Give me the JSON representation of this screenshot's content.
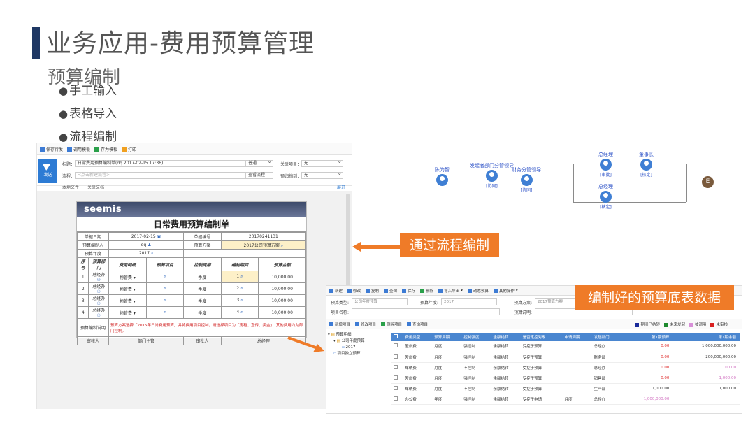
{
  "slide": {
    "title": "业务应用-费用预算管理",
    "subtitle": "预算编制",
    "bullets": [
      "手工输入",
      "表格导入",
      "流程编制"
    ]
  },
  "callouts": {
    "flow": "通过流程编制",
    "table": "编制好的预算底表数据"
  },
  "form_screen": {
    "toolbar": [
      "保存待发",
      "调用模板",
      "存为模板",
      "打印"
    ],
    "send_label": "发送",
    "title_label": "标题：",
    "title_value": "日常费用预算编制单(dq 2017-02-15 17:36)",
    "priority_value": "普通",
    "related_label": "关联项目：",
    "related_value": "无",
    "process_label": "流程：",
    "process_placeholder": "<点击新建流程>",
    "view_flow": "查看流程",
    "deadline_label": "预归档到：",
    "deadline_value": "无",
    "links": [
      "本地文件",
      "关联文档"
    ],
    "expand": "展开",
    "logo": "seemis",
    "doc_title": "日常费用预算编制单",
    "fields": {
      "date_label": "单据日期",
      "date_value": "2017-02-15",
      "no_label": "单据编号",
      "no_value": "20170241131",
      "person_label": "预算编制人",
      "person_value": "dq",
      "plan_label": "预算方案",
      "plan_value": "2017公司预算方案",
      "year_label": "预算年度",
      "year_value": "2017"
    },
    "columns": [
      "序号",
      "预算部门",
      "费用明细",
      "预算项目",
      "控制周期",
      "编制期间",
      "预算金额"
    ],
    "rows": [
      [
        "1",
        "总经办",
        "物管费",
        "",
        "季度",
        "1",
        "10,000.00"
      ],
      [
        "2",
        "总经办",
        "物管费",
        "",
        "季度",
        "2",
        "10,000.00"
      ],
      [
        "3",
        "总经办",
        "物管费",
        "",
        "季度",
        "3",
        "10,000.00"
      ],
      [
        "4",
        "总经办",
        "物管费",
        "",
        "季度",
        "4",
        "10,000.00"
      ]
    ],
    "note_label": "预算编制说明",
    "note_text": "预算方案选择「2015年日常费用预算」并将费用项目控制，请选择项目为「房租、宣传、奖金」，其他费用均为部门控制。",
    "sign": [
      "审核人",
      "部门主管",
      "审批人",
      "总经理"
    ]
  },
  "flow": {
    "nodes": [
      {
        "label": "陈为智",
        "sub": ""
      },
      {
        "label": "发起者部门分管领导",
        "sub": "[协同]"
      },
      {
        "label": "财务分管领导",
        "sub": "[协同]"
      },
      {
        "label": "总经理",
        "sub": "[审批]"
      },
      {
        "label": "董事长",
        "sub": "[核定]"
      },
      {
        "label": "总经理",
        "sub": "[核定]"
      }
    ],
    "end": "E"
  },
  "table_screen": {
    "toolbar": [
      "新建",
      "修改",
      "复制",
      "查询",
      "保存",
      "删除",
      "导入导出",
      "动态预算",
      "其他操作"
    ],
    "type_label": "预算类型:",
    "type_value": "公司年度预算",
    "year_label": "预算年度:",
    "year_value": "2017",
    "plan_label": "预算方案:",
    "plan_value": "2017预算方案",
    "item_label": "项目名称:",
    "desc_label": "预算说明:",
    "toolbar2": [
      "新增项目",
      "修改项目",
      "删除项目",
      "查询项目"
    ],
    "legend": [
      {
        "label": "期间已结转",
        "color": "#1a2a9a"
      },
      {
        "label": "未来发起",
        "color": "#1e8a2e"
      },
      {
        "label": "被调用",
        "color": "#d890d8"
      },
      {
        "label": "未审核",
        "color": "#d82020"
      }
    ],
    "tree": [
      "预算明细",
      "公司年度预算",
      "2017",
      "项目独立预算"
    ],
    "columns": [
      "",
      "费用类型",
      "预算周期",
      "控制强度",
      "金额结转",
      "是否定控对象",
      "申请周期",
      "发起部门",
      "第1期预算",
      "第1期余额"
    ],
    "rows": [
      [
        "",
        "差旅费",
        "月度",
        "强控制",
        "余额结转",
        "受控于预算",
        "",
        "总经办",
        "0.00",
        "1,000,000,000.00"
      ],
      [
        "",
        "差旅费",
        "月度",
        "强控制",
        "余额结转",
        "受控于预算",
        "",
        "财务部",
        "0.00",
        "200,000,000.00"
      ],
      [
        "",
        "车辆费",
        "月度",
        "不控制",
        "余额结转",
        "受控于预算",
        "",
        "总经办",
        "0.00",
        "100.00"
      ],
      [
        "",
        "差旅费",
        "月度",
        "强控制",
        "余额结转",
        "受控于预算",
        "",
        "销售部",
        "0.00",
        "1,000.00"
      ],
      [
        "",
        "车辆费",
        "月度",
        "不控制",
        "余额结转",
        "受控于预算",
        "",
        "生产部",
        "1,000.00",
        "1,000.00"
      ],
      [
        "",
        "办公费",
        "年度",
        "强控制",
        "余额结转",
        "受控于申请",
        "月度",
        "总经办",
        "1,000,000.00",
        ""
      ]
    ]
  },
  "colors": {
    "accent": "#ef7b28",
    "title_bar": "#1f3864",
    "header_blue": "#4a86d0"
  }
}
